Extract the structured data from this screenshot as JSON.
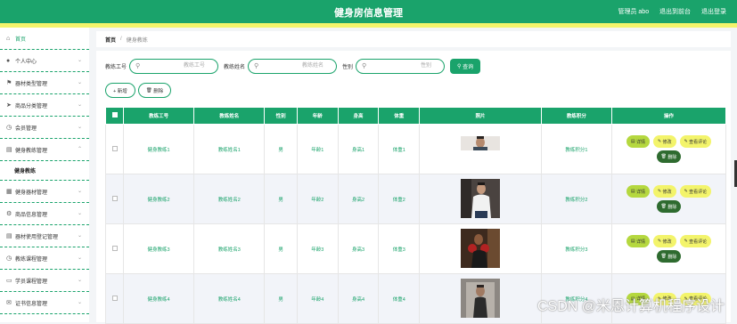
{
  "app": {
    "title": "健身房信息管理",
    "user_label": "管理员 abo",
    "exit_backend": "退出到前台",
    "logout": "退出登录"
  },
  "sidebar": {
    "items": [
      {
        "label": "首页",
        "icon": "home-icon"
      },
      {
        "label": "个人中心",
        "icon": "user-icon"
      },
      {
        "label": "器材类型管理",
        "icon": "flag-icon"
      },
      {
        "label": "商品分类管理",
        "icon": "send-icon"
      },
      {
        "label": "会员管理",
        "icon": "clock-icon"
      },
      {
        "label": "健身教练管理",
        "icon": "chat-icon"
      },
      {
        "label": "健身器材管理",
        "icon": "grid-icon"
      },
      {
        "label": "商品信息管理",
        "icon": "gear-icon"
      },
      {
        "label": "器材使用登记管理",
        "icon": "list-icon"
      },
      {
        "label": "教练课程管理",
        "icon": "clock-icon"
      },
      {
        "label": "学员课程管理",
        "icon": "chat-icon"
      },
      {
        "label": "证书信息管理",
        "icon": "mail-icon"
      }
    ],
    "sub_item": "健身教练"
  },
  "breadcrumb": {
    "home": "首页",
    "sep": "/",
    "current": "健身教练"
  },
  "search": {
    "label1": "教练工号",
    "placeholder1": "教练工号",
    "label2": "教练姓名",
    "placeholder2": "教练姓名",
    "label3": "性别",
    "placeholder3": "性别",
    "button": "查询"
  },
  "actions": {
    "add": "+ 新增",
    "delete": "删除"
  },
  "table": {
    "headers": [
      "教练工号",
      "教练姓名",
      "性别",
      "年龄",
      "身高",
      "体重",
      "照片",
      "教练积分",
      "操作"
    ],
    "rows": [
      {
        "id": "健身教练1",
        "name": "教练姓名1",
        "gender": "男",
        "age": "年龄1",
        "height": "身高1",
        "weight": "体重1",
        "points": "教练积分1"
      },
      {
        "id": "健身教练2",
        "name": "教练姓名2",
        "gender": "男",
        "age": "年龄2",
        "height": "身高2",
        "weight": "体重2",
        "points": "教练积分2"
      },
      {
        "id": "健身教练3",
        "name": "教练姓名3",
        "gender": "男",
        "age": "年龄3",
        "height": "身高3",
        "weight": "体重3",
        "points": "教练积分3"
      },
      {
        "id": "健身教练4",
        "name": "教练姓名4",
        "gender": "男",
        "age": "年龄4",
        "height": "身高4",
        "weight": "体重4",
        "points": "教练积分4"
      }
    ],
    "ops": {
      "detail": "详情",
      "edit": "修改",
      "review": "查看评论",
      "del": "删除"
    }
  },
  "watermark": "CSDN @米恩计算机程序设计",
  "colors": {
    "primary": "#1aa36b",
    "accent_yellow": "#f3f46b",
    "lime": "#b5d83f",
    "dark_green": "#2e6b2f"
  }
}
